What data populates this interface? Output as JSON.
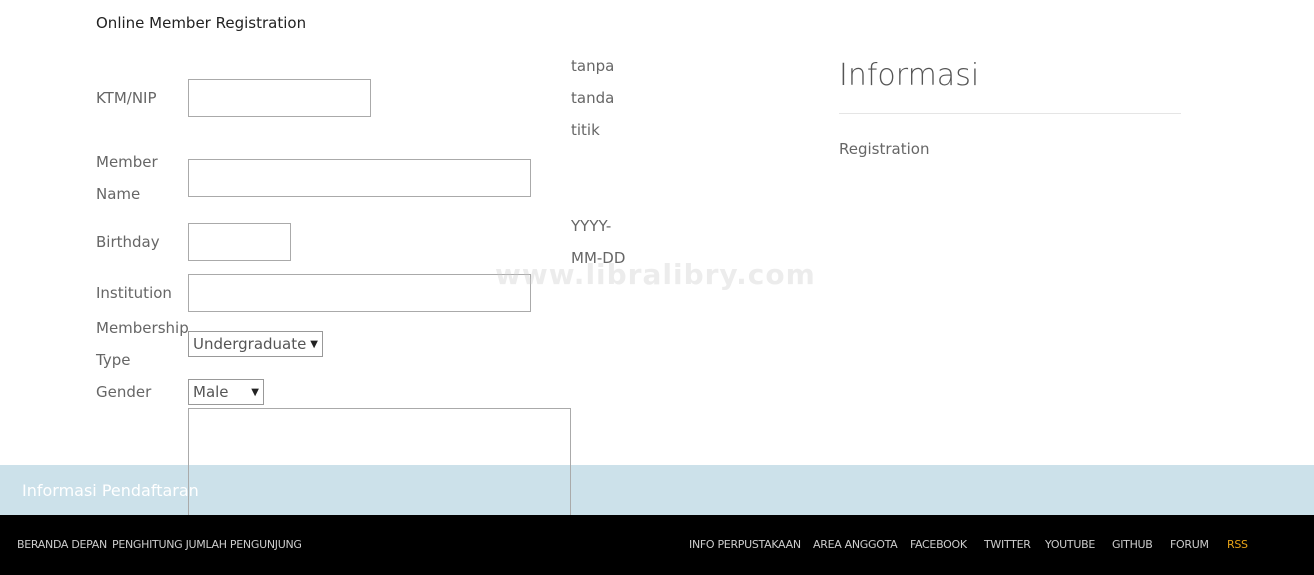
{
  "page": {
    "title": "Online Member Registration",
    "watermark": "www.libralibry.com"
  },
  "form": {
    "ktm_label_lines": [
      "KTM/NIP"
    ],
    "ktm_value": "",
    "ktm_hint": [
      "tanpa",
      "tanda",
      "titik"
    ],
    "name_label_lines": [
      "Member",
      "Name"
    ],
    "name_value": "",
    "birthday_label": "Birthday",
    "birthday_value": "",
    "birthday_hint": [
      "YYYY-",
      "MM-DD"
    ],
    "institution_label": "Institution",
    "institution_value": "",
    "membership_label_lines": [
      "Membership",
      "Type"
    ],
    "membership_selected": "Undergraduate",
    "gender_label": "Gender",
    "gender_selected": "Male",
    "address_value": ""
  },
  "sidebar": {
    "heading": "Informasi",
    "link": "Registration"
  },
  "band": {
    "label": "Informasi Pendaftaran"
  },
  "footer": {
    "left": [
      "BERANDA DEPAN",
      "PENGHITUNG JUMLAH PENGUNJUNG"
    ],
    "right": [
      "INFO PERPUSTAKAAN",
      "AREA ANGGOTA",
      "FACEBOOK",
      "TWITTER",
      "YOUTUBE",
      "GITHUB",
      "FORUM",
      "RSS"
    ],
    "rss_color": "#e8a317"
  }
}
